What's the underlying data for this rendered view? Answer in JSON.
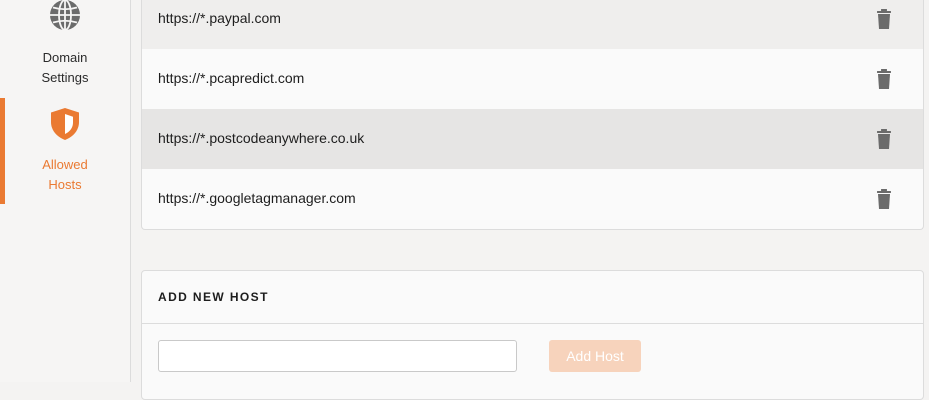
{
  "sidebar": {
    "items": [
      {
        "label_line1": "Domain",
        "label_line2": "Settings",
        "icon": "globe-icon",
        "active": false
      },
      {
        "label_line1": "Allowed",
        "label_line2": "Hosts",
        "icon": "shield-icon",
        "active": true
      }
    ],
    "accent_color": "#ea7a32"
  },
  "hosts": {
    "rows": [
      {
        "url": "https://*.paypal.com",
        "delete_icon": "trash-icon"
      },
      {
        "url": "https://*.pcapredict.com",
        "delete_icon": "trash-icon"
      },
      {
        "url": "https://*.postcodeanywhere.co.uk",
        "delete_icon": "trash-icon"
      },
      {
        "url": "https://*.googletagmanager.com",
        "delete_icon": "trash-icon"
      }
    ]
  },
  "add_host": {
    "title": "ADD NEW HOST",
    "input_value": "",
    "input_placeholder": "",
    "button_label": "Add Host",
    "button_color": "#f7d3bc"
  }
}
